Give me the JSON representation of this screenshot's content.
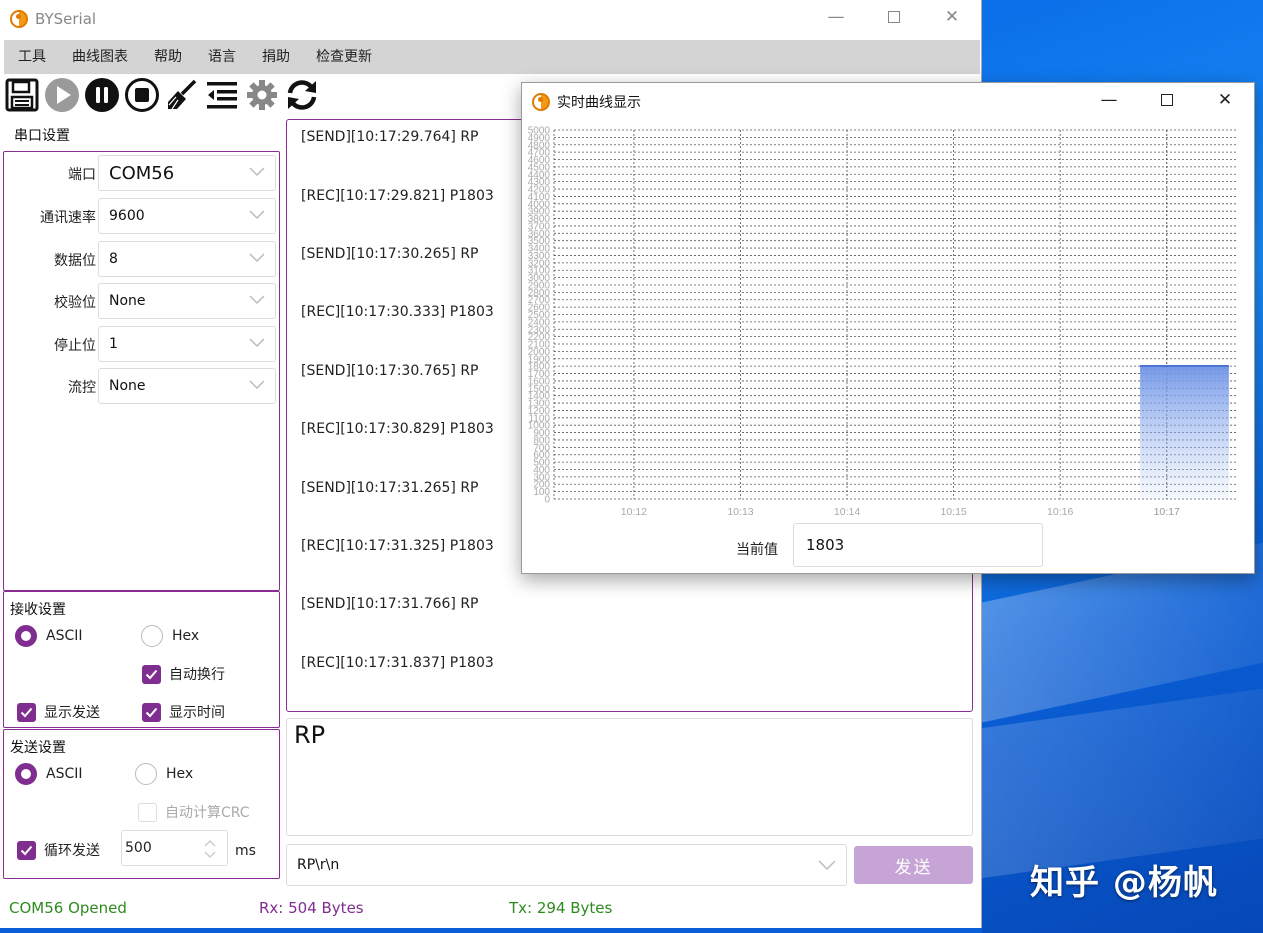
{
  "app": {
    "title": "BYSerial",
    "window_controls": [
      "minimize-icon",
      "maximize-icon",
      "close-icon"
    ]
  },
  "menu": [
    "工具",
    "曲线图表",
    "帮助",
    "语言",
    "捐助",
    "检查更新"
  ],
  "toolbar": [
    "save-icon",
    "play-icon",
    "pause-icon",
    "stop-icon",
    "clear-brush-icon",
    "list-icon",
    "gear-icon",
    "refresh-icon"
  ],
  "serial": {
    "title": "串口设置",
    "fields": [
      {
        "label": "端口",
        "value": "COM56"
      },
      {
        "label": "通讯速率",
        "value": "9600"
      },
      {
        "label": "数据位",
        "value": "8"
      },
      {
        "label": "校验位",
        "value": "None"
      },
      {
        "label": "停止位",
        "value": "1"
      },
      {
        "label": "流控",
        "value": "None"
      }
    ]
  },
  "receive": {
    "title": "接收设置",
    "ascii": "ASCII",
    "hex": "Hex",
    "autowrap": "自动换行",
    "show_send": "显示发送",
    "show_time": "显示时间"
  },
  "send": {
    "title": "发送设置",
    "ascii": "ASCII",
    "hex": "Hex",
    "crc": "自动计算CRC",
    "loop": "循环发送",
    "interval": "500",
    "unit": "ms"
  },
  "log": [
    "[SEND][10:17:29.764] RP",
    "[REC][10:17:29.821] P1803",
    "[SEND][10:17:30.265] RP",
    "[REC][10:17:30.333] P1803",
    "[SEND][10:17:30.765] RP",
    "[REC][10:17:30.829] P1803",
    "[SEND][10:17:31.265] RP",
    "[REC][10:17:31.325] P1803",
    "[SEND][10:17:31.766] RP",
    "[REC][10:17:31.837] P1803"
  ],
  "input": {
    "text": "RP",
    "history": "RP\\r\\n",
    "send_label": "发送"
  },
  "status": {
    "port": "COM56 Opened",
    "rx": "Rx: 504 Bytes",
    "tx": "Tx: 294 Bytes"
  },
  "colors": {
    "accent": "#7f2d8e",
    "status_port": "#2e8b1e",
    "status_rx": "#7f2d8e",
    "status_tx": "#2e8b1e"
  },
  "watermark": "知乎 @杨帆",
  "chart_window": {
    "title": "实时曲线显示",
    "current_label": "当前值",
    "current_value": "1803"
  },
  "chart_data": {
    "type": "area",
    "xlabel": "",
    "ylabel": "",
    "ylim": [
      0,
      5000
    ],
    "yticks": [
      0,
      100,
      200,
      300,
      400,
      500,
      600,
      700,
      800,
      900,
      1000,
      1100,
      1200,
      1300,
      1400,
      1500,
      1600,
      1700,
      1800,
      1900,
      2000,
      2100,
      2200,
      2300,
      2400,
      2500,
      2600,
      2700,
      2800,
      2900,
      3000,
      3100,
      3200,
      3300,
      3400,
      3500,
      3600,
      3700,
      3800,
      3900,
      4000,
      4100,
      4200,
      4300,
      4400,
      4500,
      4600,
      4700,
      4800,
      4900,
      5000
    ],
    "xticks": [
      "10:12",
      "10:13",
      "10:14",
      "10:15",
      "10:16",
      "10:17",
      "10:17"
    ],
    "series": [
      {
        "x": [
          "10:16:45",
          "10:17:35"
        ],
        "y": [
          1803,
          1803
        ]
      }
    ]
  }
}
